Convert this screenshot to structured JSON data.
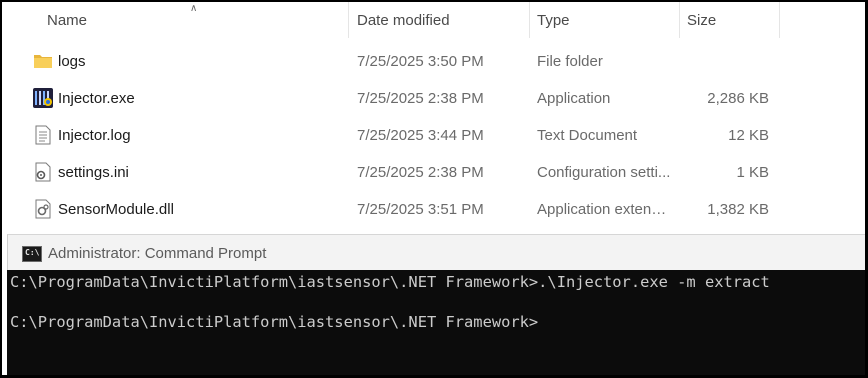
{
  "explorer": {
    "columns": {
      "name": "Name",
      "date_modified": "Date modified",
      "type": "Type",
      "size": "Size"
    },
    "files": [
      {
        "name": "logs",
        "date": "7/25/2025 3:50 PM",
        "type": "File folder",
        "size": "",
        "icon": "folder-icon"
      },
      {
        "name": "Injector.exe",
        "date": "7/25/2025 2:38 PM",
        "type": "Application",
        "size": "2,286 KB",
        "icon": "application-icon"
      },
      {
        "name": "Injector.log",
        "date": "7/25/2025 3:44 PM",
        "type": "Text Document",
        "size": "12 KB",
        "icon": "text-document-icon"
      },
      {
        "name": "settings.ini",
        "date": "7/25/2025 2:38 PM",
        "type": "Configuration setti...",
        "size": "1 KB",
        "icon": "config-file-icon"
      },
      {
        "name": "SensorModule.dll",
        "date": "7/25/2025 3:51 PM",
        "type": "Application extens...",
        "size": "1,382 KB",
        "icon": "dll-file-icon"
      }
    ]
  },
  "cmd": {
    "title": "Administrator: Command Prompt",
    "icon_text": "C:\\",
    "lines": [
      "C:\\ProgramData\\InvictiPlatform\\iastsensor\\.NET Framework>.\\Injector.exe -m extract",
      "C:\\ProgramData\\InvictiPlatform\\iastsensor\\.NET Framework>"
    ]
  }
}
